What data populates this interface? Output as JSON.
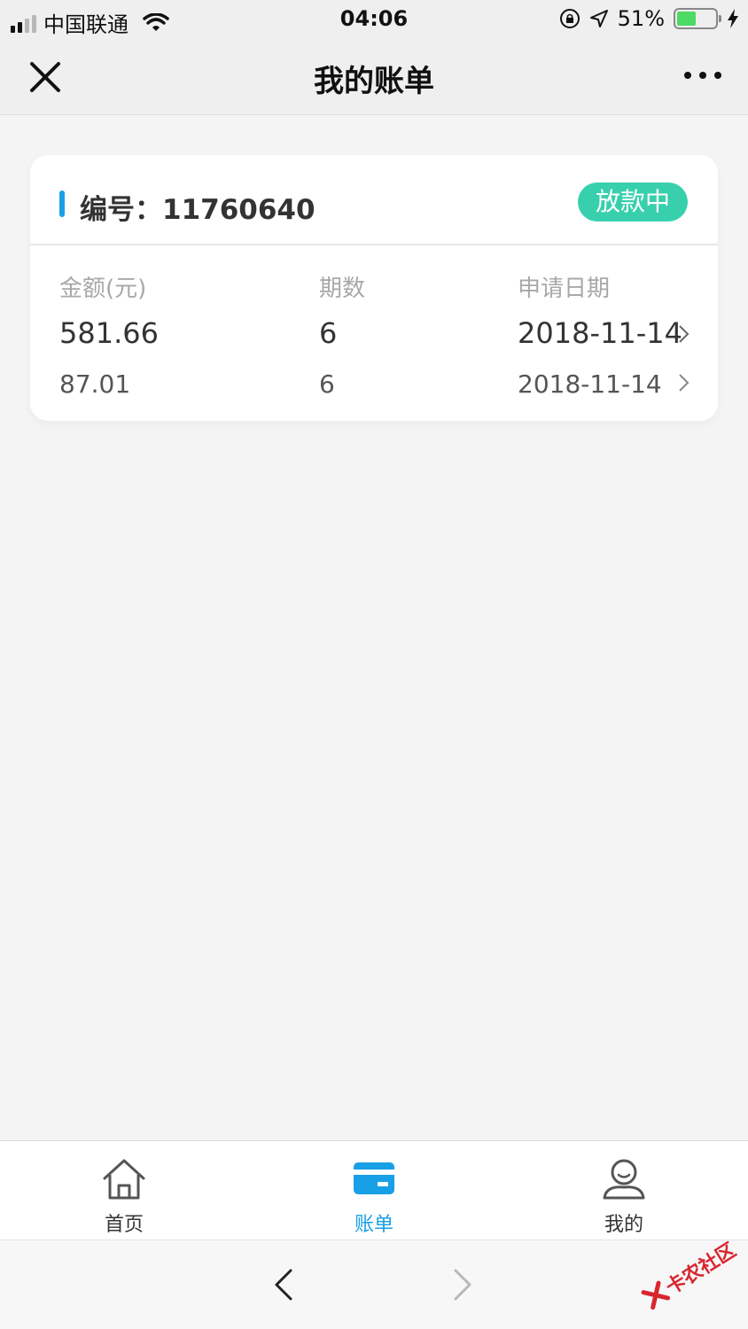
{
  "status_bar": {
    "carrier": "中国联通",
    "time": "04:06",
    "battery_percent": "51%",
    "battery_level": 0.51
  },
  "nav": {
    "title": "我的账单"
  },
  "bill_card": {
    "number_label": "编号：11760640",
    "status": "放款中",
    "columns": [
      "金额(元)",
      "期数",
      "申请日期"
    ],
    "rows": [
      {
        "amount": "581.66",
        "periods": "6",
        "date": "2018-11-14"
      },
      {
        "amount": "87.01",
        "periods": "6",
        "date": "2018-11-14"
      }
    ]
  },
  "tab_bar": {
    "tabs": [
      {
        "label": "首页",
        "icon": "home-icon"
      },
      {
        "label": "账单",
        "icon": "card-icon",
        "active": true
      },
      {
        "label": "我的",
        "icon": "user-icon"
      }
    ]
  },
  "watermark": {
    "text": "卡农社区"
  },
  "colors": {
    "accent": "#18a0e6",
    "badge": "#38d0ac",
    "background": "#f4f4f5"
  }
}
